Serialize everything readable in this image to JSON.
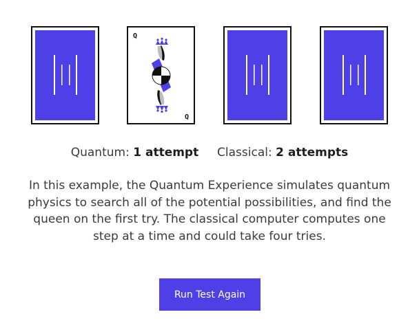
{
  "cards": [
    {
      "state": "face-down",
      "icon": "card-back-icon"
    },
    {
      "state": "face-up",
      "rank_top": "Q",
      "rank_bottom": "Q",
      "icon": "queen-card-icon"
    },
    {
      "state": "face-down",
      "icon": "card-back-icon"
    },
    {
      "state": "face-down",
      "icon": "card-back-icon"
    }
  ],
  "results": {
    "quantum_label": "Quantum:",
    "quantum_value": "1 attempt",
    "classical_label": "Classical:",
    "classical_value": "2 attempts"
  },
  "description": "In this example, the Quantum Experience simulates quantum physics to search all of the potential possibilities, and find the queen on the first try. The classical computer computes one step at a time and could take four tries.",
  "button": {
    "label": "Run Test Again"
  },
  "colors": {
    "accent": "#4f3fe6",
    "text": "#3a3a3a",
    "border": "#111111"
  }
}
